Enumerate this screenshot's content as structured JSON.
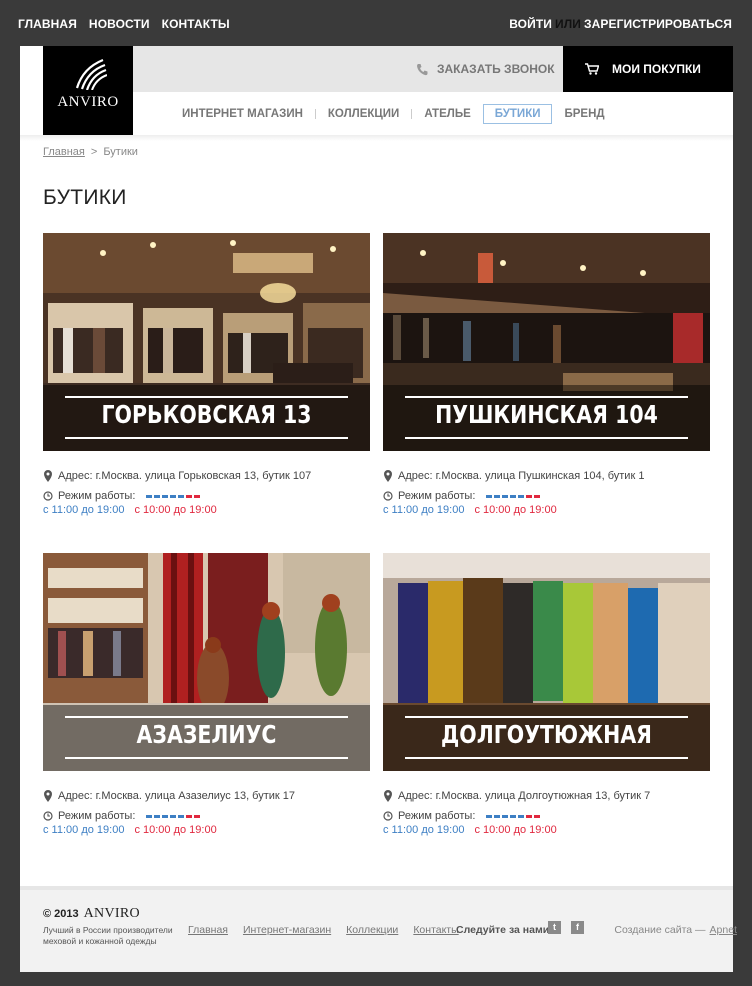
{
  "topnav": {
    "home": "Главная",
    "news": "Новости",
    "contacts": "Контакты"
  },
  "auth": {
    "login": "Войти",
    "or": "или",
    "register": "Зарегистрироваться"
  },
  "logo": {
    "name": "ANVIRO"
  },
  "header": {
    "callback": "Заказать звонок",
    "cart": "Мои покупки"
  },
  "mainnav": [
    {
      "label": "Интернет магазин"
    },
    {
      "label": "Коллекции"
    },
    {
      "label": "Ателье"
    },
    {
      "label": "Бутики",
      "active": true
    },
    {
      "label": "Бренд"
    }
  ],
  "breadcrumb": {
    "home": "Главная",
    "separator": ">",
    "current": "Бутики"
  },
  "page_title": "Бутики",
  "labels": {
    "hours": "Режим работы:"
  },
  "shops": [
    {
      "name": "ГОРЬКОВСКАЯ 13",
      "address": "Адрес: г.Москва. улица Горьковская 13, бутик 107",
      "weekday_hours": "с 11:00 до 19:00",
      "weekend_hours": "с 10:00 до 19:00"
    },
    {
      "name": "ПУШКИНСКАЯ 104",
      "address": "Адрес: г.Москва. улица Пушкинская 104, бутик 1",
      "weekday_hours": "с 11:00 до 19:00",
      "weekend_hours": "с 10:00 до 19:00"
    },
    {
      "name": "АЗАЗЕЛИУС",
      "address": "Адрес: г.Москва. улица Азазелиус 13, бутик 17",
      "weekday_hours": "с 11:00 до 19:00",
      "weekend_hours": "с 10:00 до 19:00"
    },
    {
      "name": "ДОЛГОУТЮЖНАЯ",
      "address": "Адрес: г.Москва. улица Долгоутюжная 13, бутик 7",
      "weekday_hours": "с 11:00 до 19:00",
      "weekend_hours": "с 10:00 до 19:00"
    }
  ],
  "footer": {
    "copyright": "© 2013",
    "brand": "ANVIRO",
    "tagline": "Лучший в России производители меховой и кожанной одежды",
    "links": {
      "home": "Главная",
      "shop": "Интернет-магазин",
      "collections": "Коллекции",
      "contacts": "Контакты"
    },
    "follow": "Следуйте за нами",
    "twitter": "t",
    "facebook": "f",
    "made_by": "Создание сайта —",
    "made_by_link": "Apnet"
  },
  "colors": {
    "weekday_blue": "#3d7fc4",
    "weekend_red": "#e0283f",
    "active_nav": "#7aa7d6"
  }
}
